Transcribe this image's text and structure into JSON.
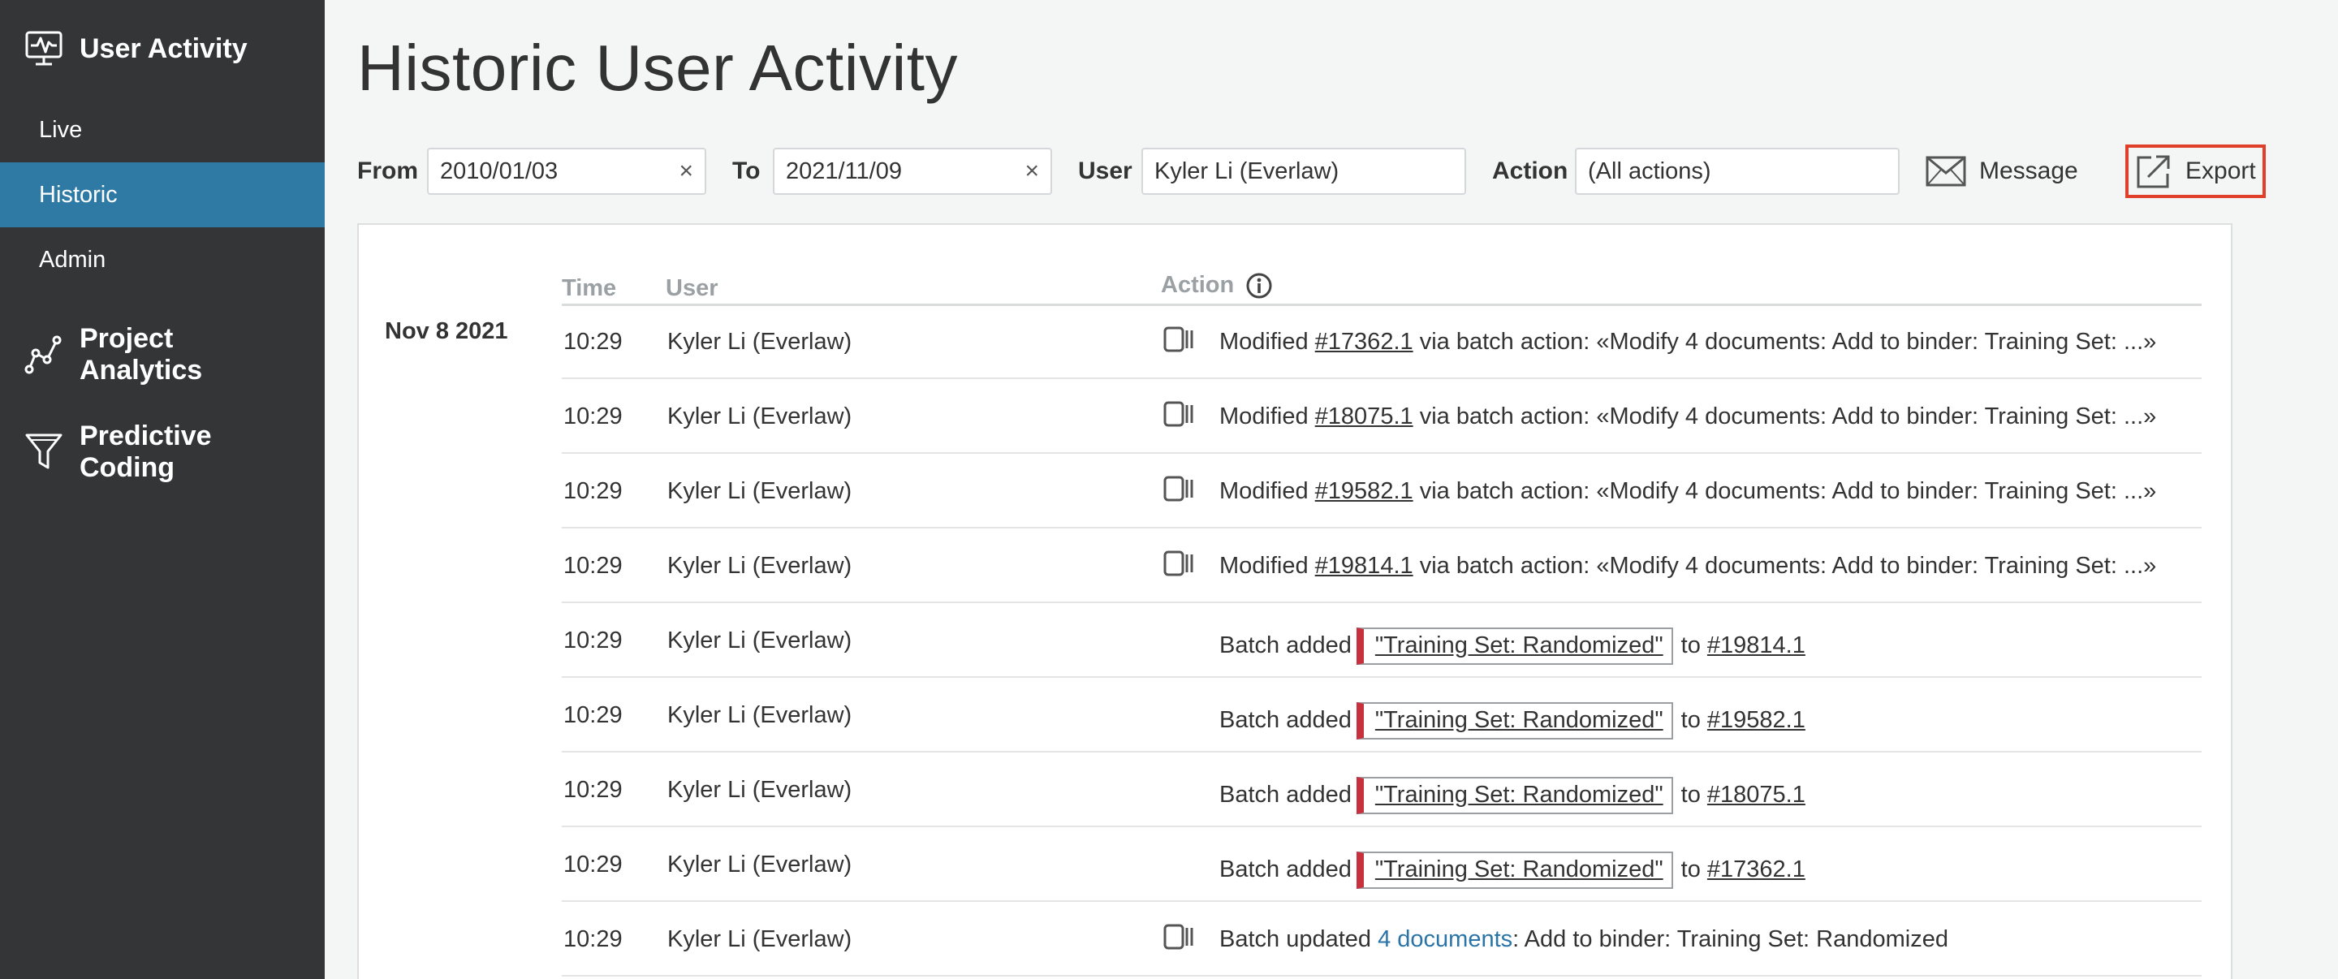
{
  "sidebar": {
    "user_activity": "User Activity",
    "items": [
      {
        "label": "Live"
      },
      {
        "label": "Historic"
      },
      {
        "label": "Admin"
      }
    ],
    "project_analytics": "Project Analytics",
    "predictive_coding": "Predictive Coding"
  },
  "page": {
    "title": "Historic User Activity"
  },
  "filters": {
    "from_label": "From",
    "from_value": "2010/01/03",
    "to_label": "To",
    "to_value": "2021/11/09",
    "user_label": "User",
    "user_value": "Kyler Li (Everlaw)",
    "action_label": "Action",
    "action_value": "(All actions)",
    "clear_glyph": "×",
    "message_label": "Message",
    "export_label": "Export"
  },
  "table": {
    "col_time": "Time",
    "col_user": "User",
    "col_action": "Action",
    "date": "Nov 8 2021",
    "rows": [
      {
        "time": "10:29",
        "user": "Kyler Li (Everlaw)",
        "pre": "Modified ",
        "link": "#17362.1",
        "post": " via batch action: «Modify 4 documents: Add to binder: Training Set: ...»"
      },
      {
        "time": "10:29",
        "user": "Kyler Li (Everlaw)",
        "pre": "Modified ",
        "link": "#18075.1",
        "post": " via batch action: «Modify 4 documents: Add to binder: Training Set: ...»"
      },
      {
        "time": "10:29",
        "user": "Kyler Li (Everlaw)",
        "pre": "Modified ",
        "link": "#19582.1",
        "post": " via batch action: «Modify 4 documents: Add to binder: Training Set: ...»"
      },
      {
        "time": "10:29",
        "user": "Kyler Li (Everlaw)",
        "pre": "Modified ",
        "link": "#19814.1",
        "post": " via batch action: «Modify 4 documents: Add to binder: Training Set: ...»"
      },
      {
        "time": "10:29",
        "user": "Kyler Li (Everlaw)",
        "pre": "Batch added",
        "binder": "\"Training Set: Randomized\"",
        "mid": "to ",
        "link": "#19814.1"
      },
      {
        "time": "10:29",
        "user": "Kyler Li (Everlaw)",
        "pre": "Batch added",
        "binder": "\"Training Set: Randomized\"",
        "mid": "to ",
        "link": "#19582.1"
      },
      {
        "time": "10:29",
        "user": "Kyler Li (Everlaw)",
        "pre": "Batch added",
        "binder": "\"Training Set: Randomized\"",
        "mid": "to ",
        "link": "#18075.1"
      },
      {
        "time": "10:29",
        "user": "Kyler Li (Everlaw)",
        "pre": "Batch added",
        "binder": "\"Training Set: Randomized\"",
        "mid": "to ",
        "link": "#17362.1"
      },
      {
        "time": "10:29",
        "user": "Kyler Li (Everlaw)",
        "pre": "Batch updated ",
        "link": "4 documents",
        "post": ": Add to binder: Training Set: Randomized"
      }
    ]
  },
  "colors": {
    "sidebar_bg": "#333536",
    "active_item": "#2f7aa5",
    "export_highlight": "#e0402a",
    "binder_tag": "#c7313e",
    "link_blue": "#2a74a7"
  }
}
